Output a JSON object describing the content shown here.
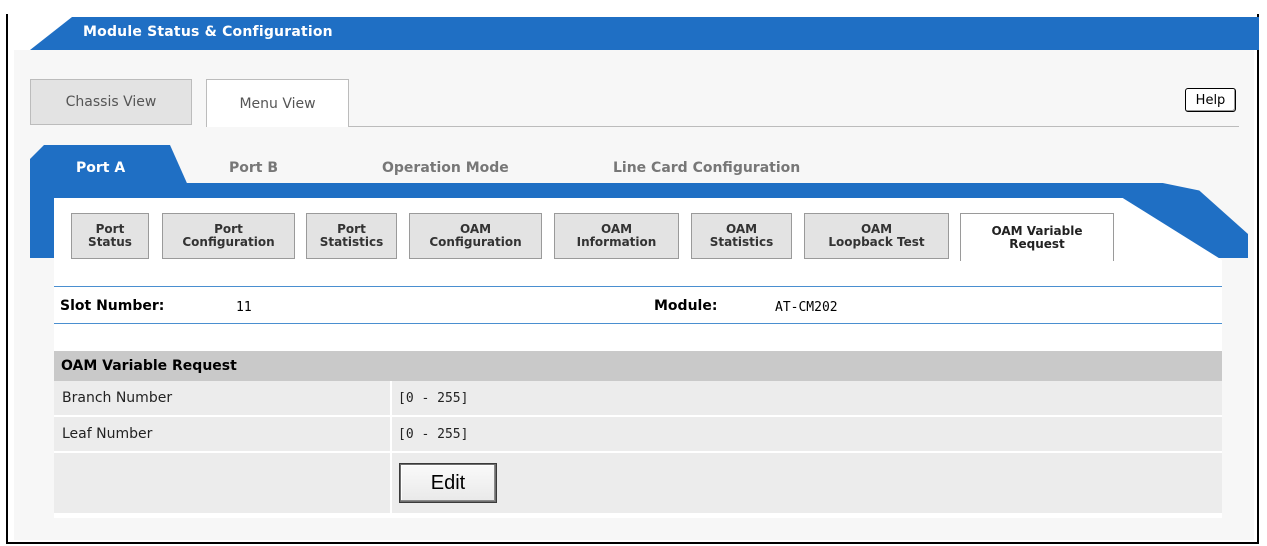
{
  "header": {
    "title": "Module Status & Configuration"
  },
  "view_tabs": [
    {
      "label": "Chassis View",
      "active": false
    },
    {
      "label": "Menu View",
      "active": true
    }
  ],
  "help_label": "Help",
  "port_tabs": [
    {
      "label": "Port A",
      "active": true
    },
    {
      "label": "Port B",
      "active": false
    },
    {
      "label": "Operation Mode",
      "active": false
    },
    {
      "label": "Line Card Configuration",
      "active": false
    }
  ],
  "sub_tabs": [
    {
      "line1": "Port",
      "line2": "Status"
    },
    {
      "line1": "Port",
      "line2": "Configuration"
    },
    {
      "line1": "Port",
      "line2": "Statistics"
    },
    {
      "line1": "OAM",
      "line2": "Configuration"
    },
    {
      "line1": "OAM",
      "line2": "Information"
    },
    {
      "line1": "OAM",
      "line2": "Statistics"
    },
    {
      "line1": "OAM",
      "line2": "Loopback Test"
    },
    {
      "line1": "OAM Variable",
      "line2": "Request",
      "active": true
    }
  ],
  "info": {
    "slot_label": "Slot Number:",
    "slot_value": "11",
    "module_label": "Module:",
    "module_value": "AT-CM202"
  },
  "section": {
    "title": "OAM Variable Request",
    "rows": [
      {
        "label": "Branch Number",
        "value": "[0 - 255]"
      },
      {
        "label": "Leaf Number",
        "value": "[0 - 255]"
      }
    ],
    "edit_label": "Edit"
  },
  "colors": {
    "brand_blue": "#1f6fc4",
    "header_gray": "#c9c9c9",
    "row_gray": "#ececec"
  }
}
